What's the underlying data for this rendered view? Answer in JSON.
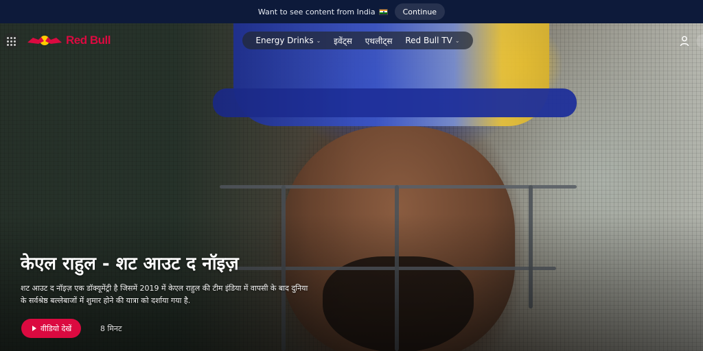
{
  "geo_banner": {
    "message": "Want to see content from India",
    "flag": "india-flag-icon",
    "continue_label": "Continue"
  },
  "header": {
    "apps_icon": "apps-grid-icon",
    "logo_text": "Red Bull",
    "nav": [
      {
        "label": "Energy Drinks",
        "has_dropdown": true
      },
      {
        "label": "इवेंट्स",
        "has_dropdown": false
      },
      {
        "label": "एथलीट्स",
        "has_dropdown": false
      },
      {
        "label": "Red Bull TV",
        "has_dropdown": true
      }
    ],
    "account_icon": "user-icon"
  },
  "hero": {
    "title": "केएल राहुल - शट आउट द नॉइज़",
    "description": "शट आउट द नॉइज़ एक डॉक्यूमेंट्री है जिसमें 2019 में केएल राहुल की टीम इंडिया में वापसी के बाद दुनिया के सर्वश्रेष्ठ बल्लेबाजों में शुमार होने की यात्रा को दर्शाया गया है.",
    "watch_label": "वीडियो देखें",
    "duration": "8 मिनट"
  },
  "colors": {
    "brand_red": "#db0a40",
    "banner_bg": "#0d1a3a",
    "continue_bg": "#27324f"
  }
}
